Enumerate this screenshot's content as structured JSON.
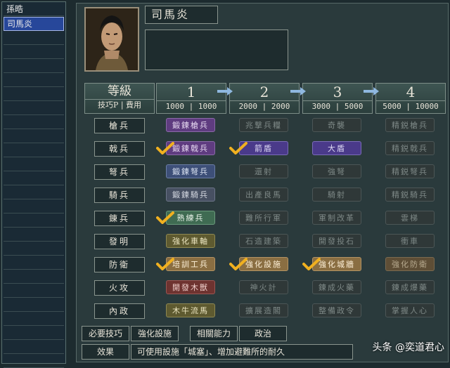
{
  "sidebar": {
    "items": [
      {
        "label": "孫晧"
      },
      {
        "label": "司馬炎"
      }
    ]
  },
  "character": {
    "name": "司馬炎"
  },
  "header": {
    "level_label": "等級",
    "cost_label": "技巧P | 費用",
    "levels": [
      "1",
      "2",
      "3",
      "4"
    ],
    "costs": [
      "1000 | 1000",
      "2000 | 2000",
      "3000 | 5000",
      "5000 | 10000"
    ]
  },
  "rows": [
    {
      "label": "槍兵",
      "techs": [
        "鍛鍊槍兵",
        "兆撃兵糧",
        "奇襲",
        "精鋭槍兵"
      ]
    },
    {
      "label": "戟兵",
      "techs": [
        "鍛鍊戟兵",
        "箭盾",
        "大盾",
        "精鋭戟兵"
      ]
    },
    {
      "label": "弩兵",
      "techs": [
        "鍛鍊弩兵",
        "還射",
        "強弩",
        "精鋭弩兵"
      ]
    },
    {
      "label": "騎兵",
      "techs": [
        "鍛鍊騎兵",
        "出產良馬",
        "騎射",
        "精鋭騎兵"
      ]
    },
    {
      "label": "錬兵",
      "techs": [
        "熟練兵",
        "難所行軍",
        "軍制改革",
        "雲梯"
      ]
    },
    {
      "label": "發明",
      "techs": [
        "強化車軸",
        "石造建築",
        "開發投石",
        "衝車"
      ]
    },
    {
      "label": "防衛",
      "techs": [
        "培訓工兵",
        "強化設施",
        "強化城牆",
        "強化防衛"
      ]
    },
    {
      "label": "火攻",
      "techs": [
        "開發木獣",
        "神火計",
        "錬成火藥",
        "錬成爆藥"
      ]
    },
    {
      "label": "內政",
      "techs": [
        "木牛流馬",
        "擴展造閣",
        "整備政令",
        "掌握人心"
      ]
    }
  ],
  "footer": {
    "req_label": "必要技巧",
    "req_value": "強化設施",
    "rel_label": "相關能力",
    "rel_value": "政治",
    "effect_label": "效果",
    "effect_value": "可使用設施「城塞」、增加避難所的耐久"
  },
  "watermark": "头条 @奕道君心"
}
